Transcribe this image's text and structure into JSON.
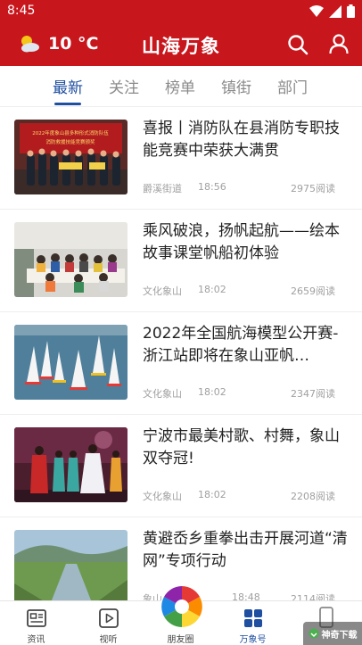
{
  "status_bar": {
    "time": "8:45"
  },
  "header": {
    "temperature": "10 °C",
    "title": "山海万象"
  },
  "tabs": [
    {
      "label": "最新",
      "active": true
    },
    {
      "label": "关注",
      "active": false
    },
    {
      "label": "榜单",
      "active": false
    },
    {
      "label": "镇街",
      "active": false
    },
    {
      "label": "部门",
      "active": false
    }
  ],
  "feed": [
    {
      "title": "喜报丨消防队在县消防专职技能竞赛中荣获大满贯",
      "source": "爵溪街道",
      "time": "18:56",
      "reads": "2975阅读",
      "thumb_text": "2022年度象山县多种形式消防队伍 消防救援技能竞赛颁奖"
    },
    {
      "title": "乘风破浪，扬帆起航——绘本故事课堂帆船初体验",
      "source": "文化象山",
      "time": "18:02",
      "reads": "2659阅读"
    },
    {
      "title": "2022年全国航海模型公开赛-浙江站即将在象山亚帆…",
      "source": "文化象山",
      "time": "18:02",
      "reads": "2347阅读"
    },
    {
      "title": "宁波市最美村歌、村舞，象山双夺冠!",
      "source": "文化象山",
      "time": "18:02",
      "reads": "2208阅读"
    },
    {
      "title": "黄避岙乡重拳出击开展河道“清网”专项行动",
      "source": "象山",
      "time": "18:48",
      "reads": "2114阅读"
    }
  ],
  "bottom_nav": [
    {
      "label": "资讯",
      "icon": "news-icon",
      "active": false
    },
    {
      "label": "视听",
      "icon": "video-icon",
      "active": false
    },
    {
      "label": "朋友圈",
      "icon": "aperture-icon",
      "active": false
    },
    {
      "label": "万象号",
      "icon": "grid-icon",
      "active": true
    },
    {
      "label": "",
      "icon": "phone-icon",
      "active": false
    }
  ],
  "watermark": "神奇下载",
  "colors": {
    "brand_red": "#c8161d",
    "accent_blue": "#1f4fa0"
  }
}
